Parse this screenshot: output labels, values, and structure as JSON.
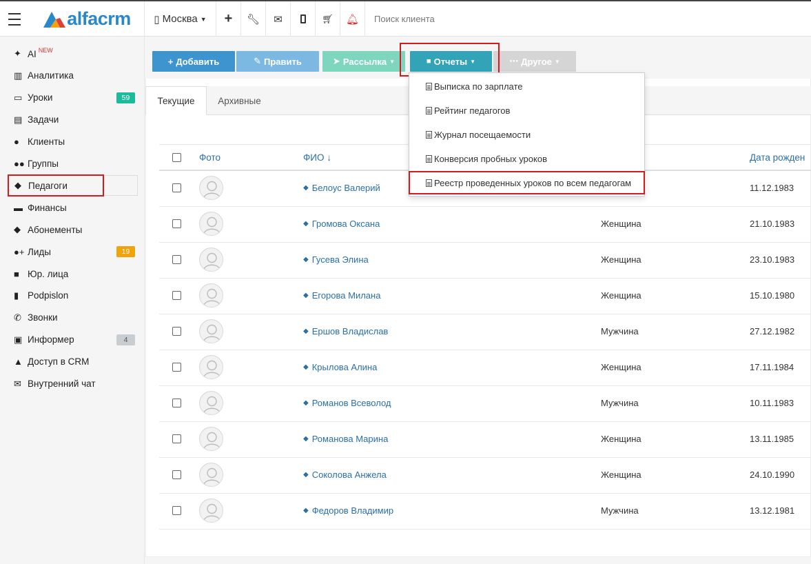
{
  "topbar": {
    "logo": "alfacrm",
    "city": "Москва",
    "search_placeholder": "Поиск клиента"
  },
  "sidebar": {
    "items": [
      {
        "label": "AI",
        "sup": "NEW",
        "icon": "sparkle-icon"
      },
      {
        "label": "Аналитика",
        "icon": "book-icon"
      },
      {
        "label": "Уроки",
        "icon": "calendar-icon",
        "badge": "59",
        "badge_color": "#1bbc9b"
      },
      {
        "label": "Задачи",
        "icon": "clipboard-icon"
      },
      {
        "label": "Клиенты",
        "icon": "user-icon"
      },
      {
        "label": "Группы",
        "icon": "users-icon"
      },
      {
        "label": "Педагоги",
        "icon": "graduation-cap-icon"
      },
      {
        "label": "Финансы",
        "icon": "money-icon"
      },
      {
        "label": "Абонементы",
        "icon": "tag-icon"
      },
      {
        "label": "Лиды",
        "icon": "user-plus-icon",
        "badge": "19",
        "badge_color": "#f0a30a"
      },
      {
        "label": "Юр. лица",
        "icon": "briefcase-icon"
      },
      {
        "label": "Podpislon",
        "icon": "file-icon"
      },
      {
        "label": "Звонки",
        "icon": "phone-icon"
      },
      {
        "label": "Информер",
        "icon": "inbox-icon",
        "badge": "4",
        "badge_color": "#c8cdd2"
      },
      {
        "label": "Доступ в CRM",
        "icon": "lock-icon"
      },
      {
        "label": "Внутренний чат",
        "icon": "envelope-icon"
      }
    ]
  },
  "toolbar": {
    "add": "Добавить",
    "edit": "Править",
    "mailing": "Рассылка",
    "reports": "Отчеты",
    "other": "Другое"
  },
  "tabs": [
    "Текущие",
    "Архивные"
  ],
  "table": {
    "headers": {
      "photo": "Фото",
      "name": "ФИО ↓",
      "dob": "Дата рожден"
    },
    "rows": [
      {
        "name": "Белоус Валерий",
        "gender": "",
        "dob": "11.12.1983"
      },
      {
        "name": "Громова Оксана",
        "gender": "Женщина",
        "dob": "21.10.1983"
      },
      {
        "name": "Гусева Элина",
        "gender": "Женщина",
        "dob": "23.10.1983"
      },
      {
        "name": "Егорова Милана",
        "gender": "Женщина",
        "dob": "15.10.1980"
      },
      {
        "name": "Ершов Владислав",
        "gender": "Мужчина",
        "dob": "27.12.1982"
      },
      {
        "name": "Крылова Алина",
        "gender": "Женщина",
        "dob": "17.11.1984"
      },
      {
        "name": "Романов Всеволод",
        "gender": "Мужчина",
        "dob": "10.11.1983"
      },
      {
        "name": "Романова Марина",
        "gender": "Женщина",
        "dob": "13.11.1985"
      },
      {
        "name": "Соколова Анжела",
        "gender": "Женщина",
        "dob": "24.10.1990"
      },
      {
        "name": "Федоров Владимир",
        "gender": "Мужчина",
        "dob": "13.12.1981"
      }
    ]
  },
  "reports_menu": [
    "Выписка по зарплате",
    "Рейтинг педагогов",
    "Журнал посещаемости",
    "Конверсия пробных уроков",
    "Реестр проведенных уроков по всем педагогам"
  ]
}
